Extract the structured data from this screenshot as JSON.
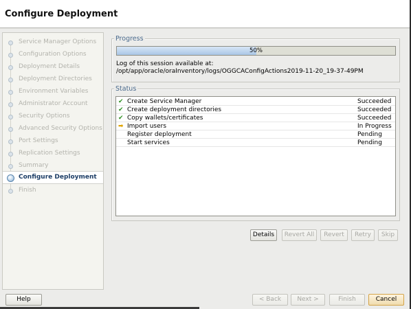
{
  "window": {
    "title": "Configure Deployment"
  },
  "steps": [
    "Service Manager Options",
    "Configuration Options",
    "Deployment Details",
    "Deployment Directories",
    "Environment Variables",
    "Administrator Account",
    "Security Options",
    "Advanced Security Options",
    "Port Settings",
    "Replication Settings",
    "Summary",
    "Configure Deployment",
    "Finish"
  ],
  "active_step": "Configure Deployment",
  "progress": {
    "title": "Progress",
    "percent": 50,
    "percent_label": "50%",
    "log_label": "Log of this session available at:",
    "log_path": "/opt/app/oracle/oraInventory/logs/OGGCAConfigActions2019-11-20_19-37-49PM"
  },
  "status": {
    "title": "Status",
    "rows": [
      {
        "icon": "check-icon",
        "task": "Create Service Manager",
        "state": "Succeeded"
      },
      {
        "icon": "check-icon",
        "task": "Create deployment directories",
        "state": "Succeeded"
      },
      {
        "icon": "check-icon",
        "task": "Copy wallets/certificates",
        "state": "Succeeded"
      },
      {
        "icon": "arrow-right-icon",
        "task": "Import users",
        "state": "In Progress"
      },
      {
        "icon": "",
        "task": "Register deployment",
        "state": "Pending"
      },
      {
        "icon": "",
        "task": "Start services",
        "state": "Pending"
      }
    ]
  },
  "actions": {
    "details": "Details",
    "revert_all": "Revert All",
    "revert": "Revert",
    "retry": "Retry",
    "skip": "Skip"
  },
  "footer": {
    "help": "Help",
    "back": "< Back",
    "next": "Next >",
    "finish": "Finish",
    "cancel": "Cancel"
  },
  "colors": {
    "progress_fill": "#a9c6e6",
    "group_title": "#4a6a8d",
    "success": "#2f8f22",
    "in_progress": "#e0a400"
  }
}
